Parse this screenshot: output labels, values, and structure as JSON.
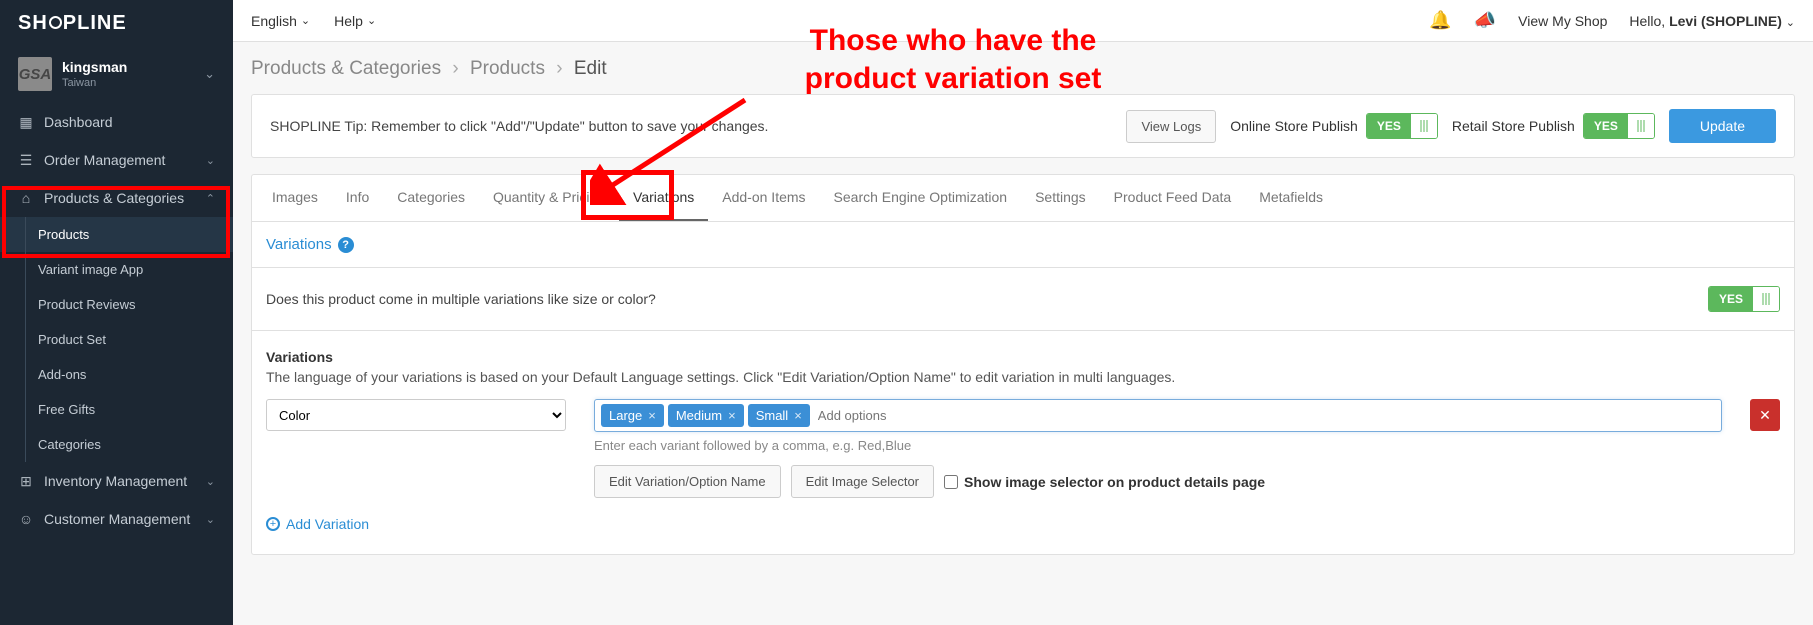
{
  "brand": "SHOPLINE",
  "merchant": {
    "avatar": "GSA",
    "name": "kingsman",
    "country": "Taiwan"
  },
  "sidebar": {
    "dashboard": "Dashboard",
    "order_mgmt": "Order Management",
    "products_cat": "Products & Categories",
    "sub": {
      "products": "Products",
      "variant_app": "Variant image App",
      "reviews": "Product Reviews",
      "product_set": "Product Set",
      "addons": "Add-ons",
      "free_gifts": "Free Gifts",
      "categories": "Categories"
    },
    "inventory": "Inventory Management",
    "customer": "Customer Management"
  },
  "topbar": {
    "english": "English",
    "help": "Help",
    "view_shop": "View My Shop",
    "hello": "Hello, ",
    "user": "Levi (SHOPLINE)"
  },
  "breadcrumb": {
    "a": "Products & Categories",
    "b": "Products",
    "c": "Edit"
  },
  "tipbar": {
    "tip": "SHOPLINE Tip: Remember to click \"Add\"/\"Update\" button to save your changes.",
    "view_logs": "View Logs",
    "online_publish": "Online Store Publish",
    "retail_publish": "Retail Store Publish",
    "yes": "YES",
    "update": "Update"
  },
  "tabs": {
    "images": "Images",
    "info": "Info",
    "categories": "Categories",
    "qty_pricing": "Quantity & Pricing",
    "variations": "Variations",
    "addon": "Add-on Items",
    "seo": "Search Engine Optimization",
    "settings": "Settings",
    "feed": "Product Feed Data",
    "metafields": "Metafields"
  },
  "variations": {
    "title": "Variations",
    "question": "Does this product come in multiple variations like size or color?",
    "yes": "YES",
    "heading": "Variations",
    "desc": "The language of your variations is based on your Default Language settings. Click \"Edit Variation/Option Name\" to edit variation in multi languages.",
    "select_value": "Color",
    "tags": [
      "Large",
      "Medium",
      "Small"
    ],
    "placeholder": "Add options",
    "hint": "Enter each variant followed by a comma, e.g. Red,Blue",
    "edit_name": "Edit Variation/Option Name",
    "edit_selector": "Edit Image Selector",
    "show_selector": "Show image selector on product details page",
    "add_variation": "Add Variation"
  },
  "annotation": {
    "line1": "Those who have the",
    "line2": "product variation set"
  }
}
